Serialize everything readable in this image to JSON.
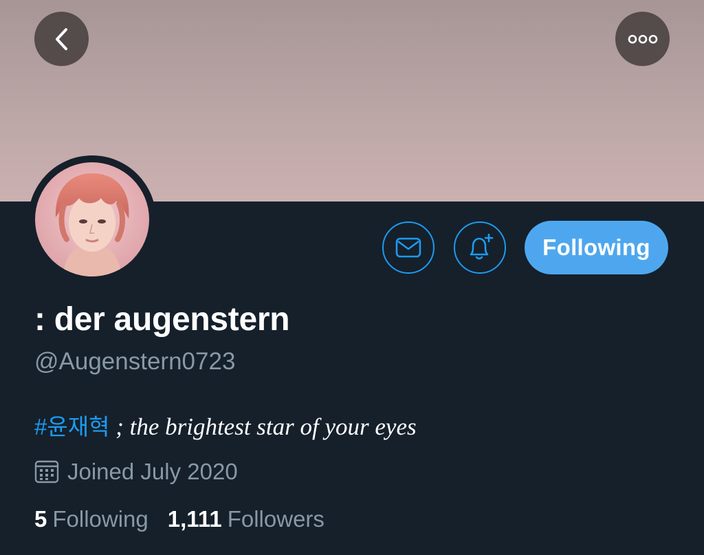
{
  "header": {
    "back_icon": "chevron-left-icon",
    "more_icon": "more-horizontal-icon",
    "banner_color": "#bba6a6"
  },
  "actions": {
    "message_icon": "envelope-icon",
    "notify_icon": "bell-plus-icon",
    "follow_label": "Following",
    "accent_color": "#1d9bf0"
  },
  "profile": {
    "display_name": ": der augenstern",
    "handle": "@Augenstern0723",
    "bio_hashtag": "#윤재혁",
    "bio_text": " ; the brightest star of your eyes",
    "joined_icon": "calendar-icon",
    "joined": "Joined July 2020"
  },
  "stats": {
    "following_count": "5",
    "following_label": "Following",
    "followers_count": "1,111",
    "followers_label": "Followers"
  }
}
